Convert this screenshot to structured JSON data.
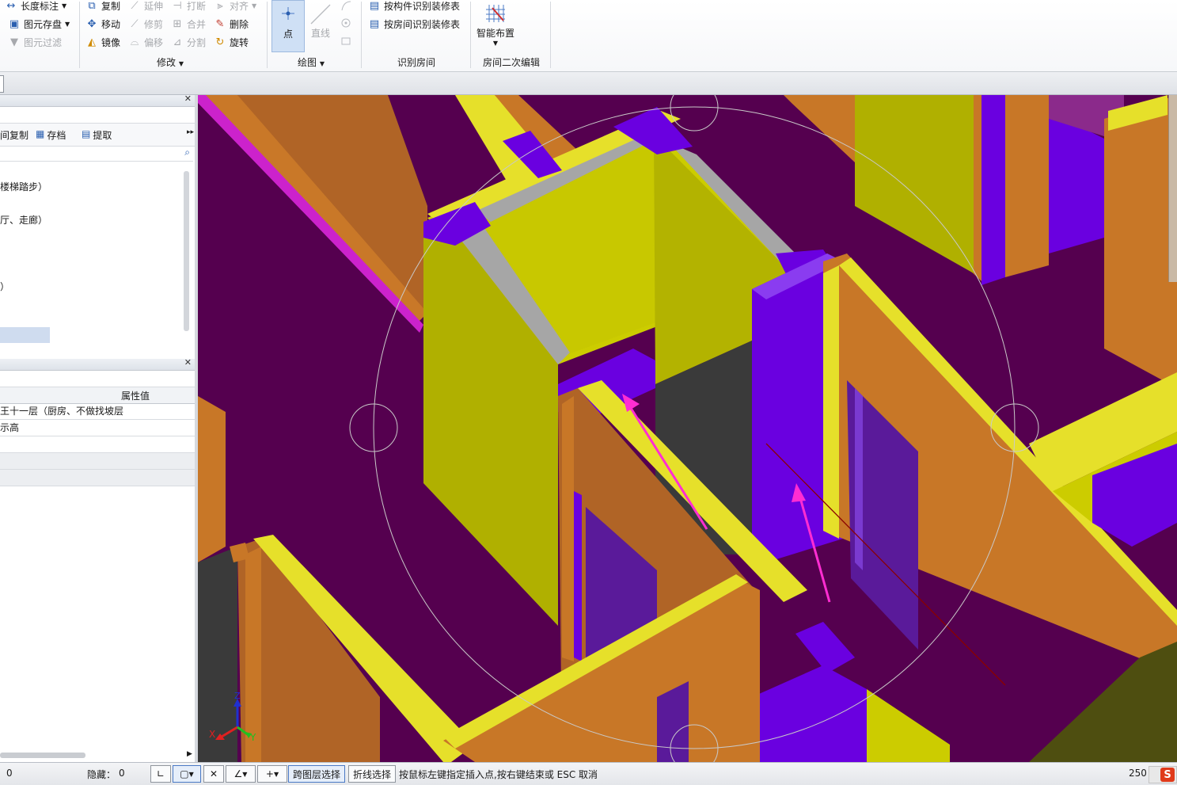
{
  "ribbon": {
    "col1": {
      "length_dim": "长度标注",
      "save_element": "图元存盘",
      "filter_element": "图元过滤"
    },
    "modify": {
      "copy": "复制",
      "extend": "延伸",
      "break": "打断",
      "align": "对齐",
      "move": "移动",
      "trim": "修剪",
      "merge": "合并",
      "delete": "删除",
      "mirror": "镜像",
      "offset": "偏移",
      "split": "分割",
      "rotate": "旋转",
      "group_label": "修改"
    },
    "draw": {
      "point": "点",
      "line": "直线",
      "group_label": "绘图"
    },
    "identify": {
      "by_component": "按构件识别装修表",
      "by_room": "按房间识别装修表",
      "group_label": "识别房间"
    },
    "room_edit": {
      "smart_layout": "智能布置",
      "group_label": "房间二次编辑"
    }
  },
  "tree_panel": {
    "toolbar": {
      "copy": "间复制",
      "archive": "存档",
      "extract": "提取"
    },
    "search_placeholder": "",
    "items": [
      "楼梯踏步）",
      "厅、走廊）",
      "）"
    ]
  },
  "property_panel": {
    "header_value": "属性值",
    "rows": [
      "王十一层（厨房、不做找坡层",
      "示高"
    ]
  },
  "axis": {
    "x": "X",
    "y": "Y",
    "z": "Z"
  },
  "status": {
    "coord": "0",
    "hidden_label": "隐藏：",
    "hidden_count": "0",
    "cross_layer": "跨图层选择",
    "polyline_select": "折线选择",
    "hint": "按鼠标左键指定插入点,按右键结束或 ESC 取消",
    "number": "250",
    "brand": "S"
  },
  "colors": {
    "floor": "#55004f",
    "wall_orange": "#c87727",
    "wall_yellow": "#cccc00",
    "column_purple": "#6a00e0",
    "arrow_magenta": "#ff2dd2"
  }
}
